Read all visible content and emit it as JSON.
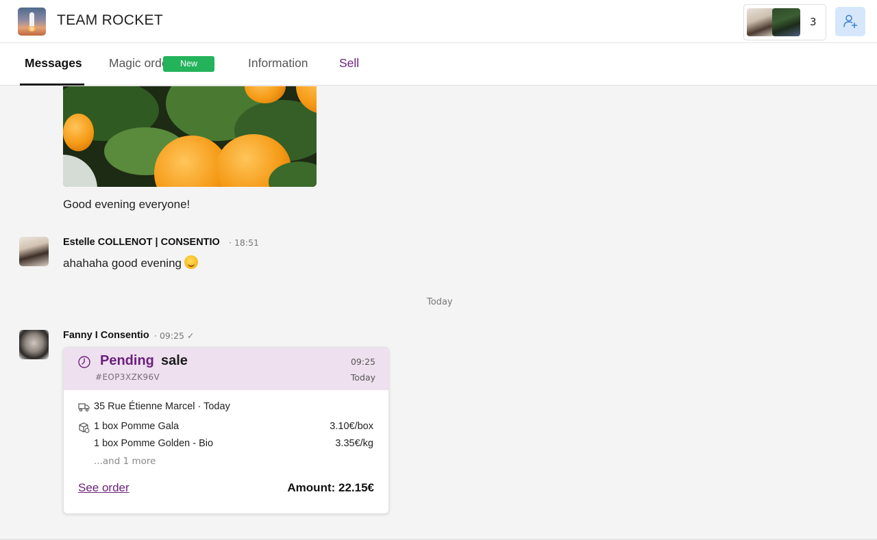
{
  "header": {
    "team_name": "TEAM ROCKET",
    "member_count": "3"
  },
  "tabs": [
    {
      "label": "Messages",
      "active": true
    },
    {
      "label": "Magic orders",
      "badge": "New"
    },
    {
      "label": "Information"
    },
    {
      "label": "Sell"
    }
  ],
  "messages": {
    "first": {
      "text": "Good evening everyone!"
    },
    "estelle": {
      "sender": "Estelle COLLENOT | CONSENTIO",
      "time": "· 18:51",
      "text": "ahahaha good evening"
    },
    "day_separator": "Today",
    "fanny": {
      "sender": "Fanny I Consentio",
      "time": "· 09:25 ✓"
    }
  },
  "order": {
    "status": "Pending",
    "type": "sale",
    "reference": "#EOP3XZK96V",
    "time": "09:25",
    "day": "Today",
    "delivery": "35 Rue Étienne Marcel · Today",
    "items": [
      {
        "name": "1 box Pomme Gala",
        "price": "3.10€/box"
      },
      {
        "name": "1 box Pomme Golden - Bio",
        "price": "3.35€/kg"
      }
    ],
    "more": "...and 1 more",
    "see_order_label": "See order",
    "amount": "Amount: 22.15€"
  },
  "colors": {
    "accent": "#6b1f7a",
    "badge_green": "#24b35b",
    "order_header_bg": "#eee0ef",
    "add_button_bg": "#d6e7fb"
  },
  "icons": [
    "clock-icon",
    "truck-icon",
    "box-icon",
    "add-user-icon",
    "check-icon"
  ]
}
